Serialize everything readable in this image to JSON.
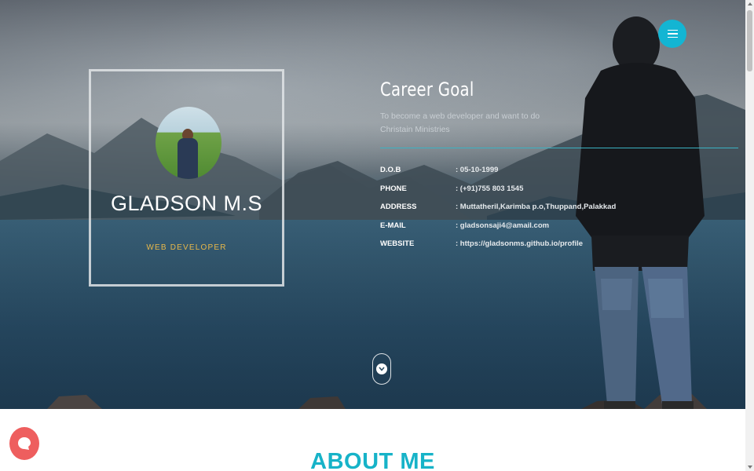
{
  "profile": {
    "name": "GLADSON M.S",
    "role": "WEB DEVELOPER"
  },
  "career": {
    "title": "Career Goal",
    "text": "To become a web developer and want to do Christain Ministries"
  },
  "info": [
    {
      "key": "D.O.B",
      "value": ": 05-10-1999"
    },
    {
      "key": "PHONE",
      "value": ": (+91)755 803 1545"
    },
    {
      "key": "ADDRESS",
      "value": ": Muttatheril,Karimba p.o,Thuppand,Palakkad"
    },
    {
      "key": "E-MAIL",
      "value": ":  gladsonsaji4@amail.com"
    },
    {
      "key": "WEBSITE",
      "value": ": https://gladsonms.github.io/profile"
    }
  ],
  "about": {
    "title": "ABOUT ME"
  },
  "icons": {
    "menu": "hamburger-icon",
    "scroll": "chevron-down-icon",
    "chat": "chat-bubble-icon"
  },
  "colors": {
    "accent": "#13b5d3",
    "role": "#e8b84a",
    "about_title": "#17b3c8",
    "chat": "#ee5e5e",
    "divider": "#3ab3c4"
  }
}
